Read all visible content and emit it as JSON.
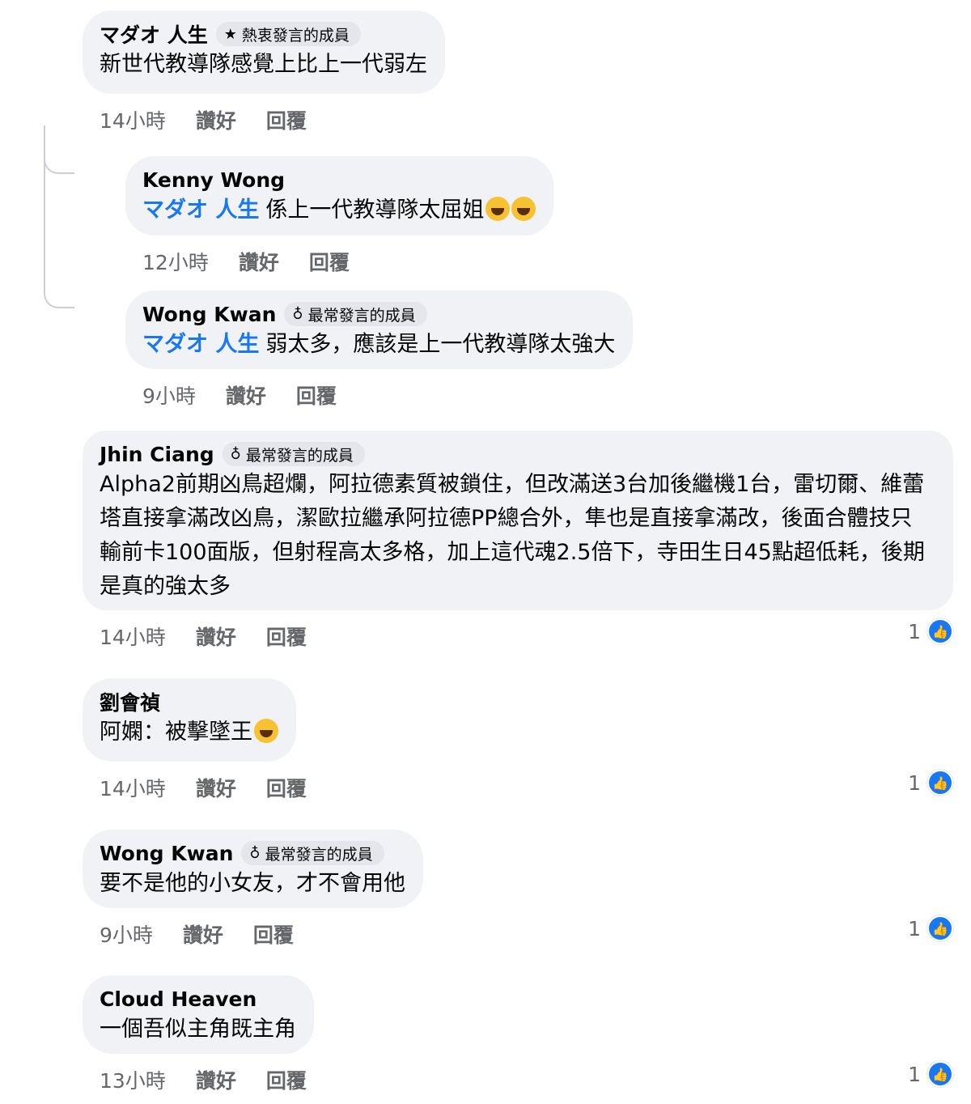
{
  "comments": [
    {
      "author": "マダオ 人生",
      "badge_icon": "star-icon",
      "badge": "熱衷發言的成員",
      "text": "新世代教導隊感覺上比上一代弱左",
      "time": "14小時",
      "like": "讚好",
      "reply": "回覆"
    },
    {
      "author": "Kenny Wong",
      "mention": "マダオ 人生",
      "text": "係上一代教導隊太屈姐",
      "emojis": [
        "laughing-tears-emoji",
        "laughing-tears-emoji"
      ],
      "time": "12小時",
      "like": "讚好",
      "reply": "回覆"
    },
    {
      "author": "Wong Kwan",
      "badge_icon": "medal-icon",
      "badge": "最常發言的成員",
      "mention": "マダオ 人生",
      "text": "弱太多，應該是上一代教導隊太強大",
      "time": "9小時",
      "like": "讚好",
      "reply": "回覆"
    },
    {
      "author": "Jhin Ciang",
      "badge_icon": "medal-icon",
      "badge": "最常發言的成員",
      "text": "Alpha2前期凶鳥超爛，阿拉德素質被鎖住，但改滿送3台加後繼機1台，雷切爾、維蕾塔直接拿滿改凶鳥，潔歐拉繼承阿拉德PP總合外，隼也是直接拿滿改，後面合體技只輸前卡100面版，但射程高太多格，加上這代魂2.5倍下，寺田生日45點超低耗，後期是真的強太多",
      "time": "14小時",
      "like": "讚好",
      "reply": "回覆",
      "reaction_count": "1"
    },
    {
      "author": "劉會禎",
      "text": "阿嫻：被擊墜王",
      "emojis": [
        "laughing-rolling-emoji"
      ],
      "time": "14小時",
      "like": "讚好",
      "reply": "回覆",
      "reaction_count": "1"
    },
    {
      "author": "Wong Kwan",
      "badge_icon": "medal-icon",
      "badge": "最常發言的成員",
      "text": "要不是他的小女友，才不會用他",
      "time": "9小時",
      "like": "讚好",
      "reply": "回覆",
      "reaction_count": "1"
    },
    {
      "author": "Cloud Heaven",
      "text": "一個吾似主角既主角",
      "time": "13小時",
      "like": "讚好",
      "reply": "回覆",
      "reaction_count": "1"
    }
  ],
  "colors": {
    "bubble": "#f0f2f5",
    "mention": "#1877f2",
    "meta": "#65676b",
    "like_icon": "#1877f2"
  }
}
